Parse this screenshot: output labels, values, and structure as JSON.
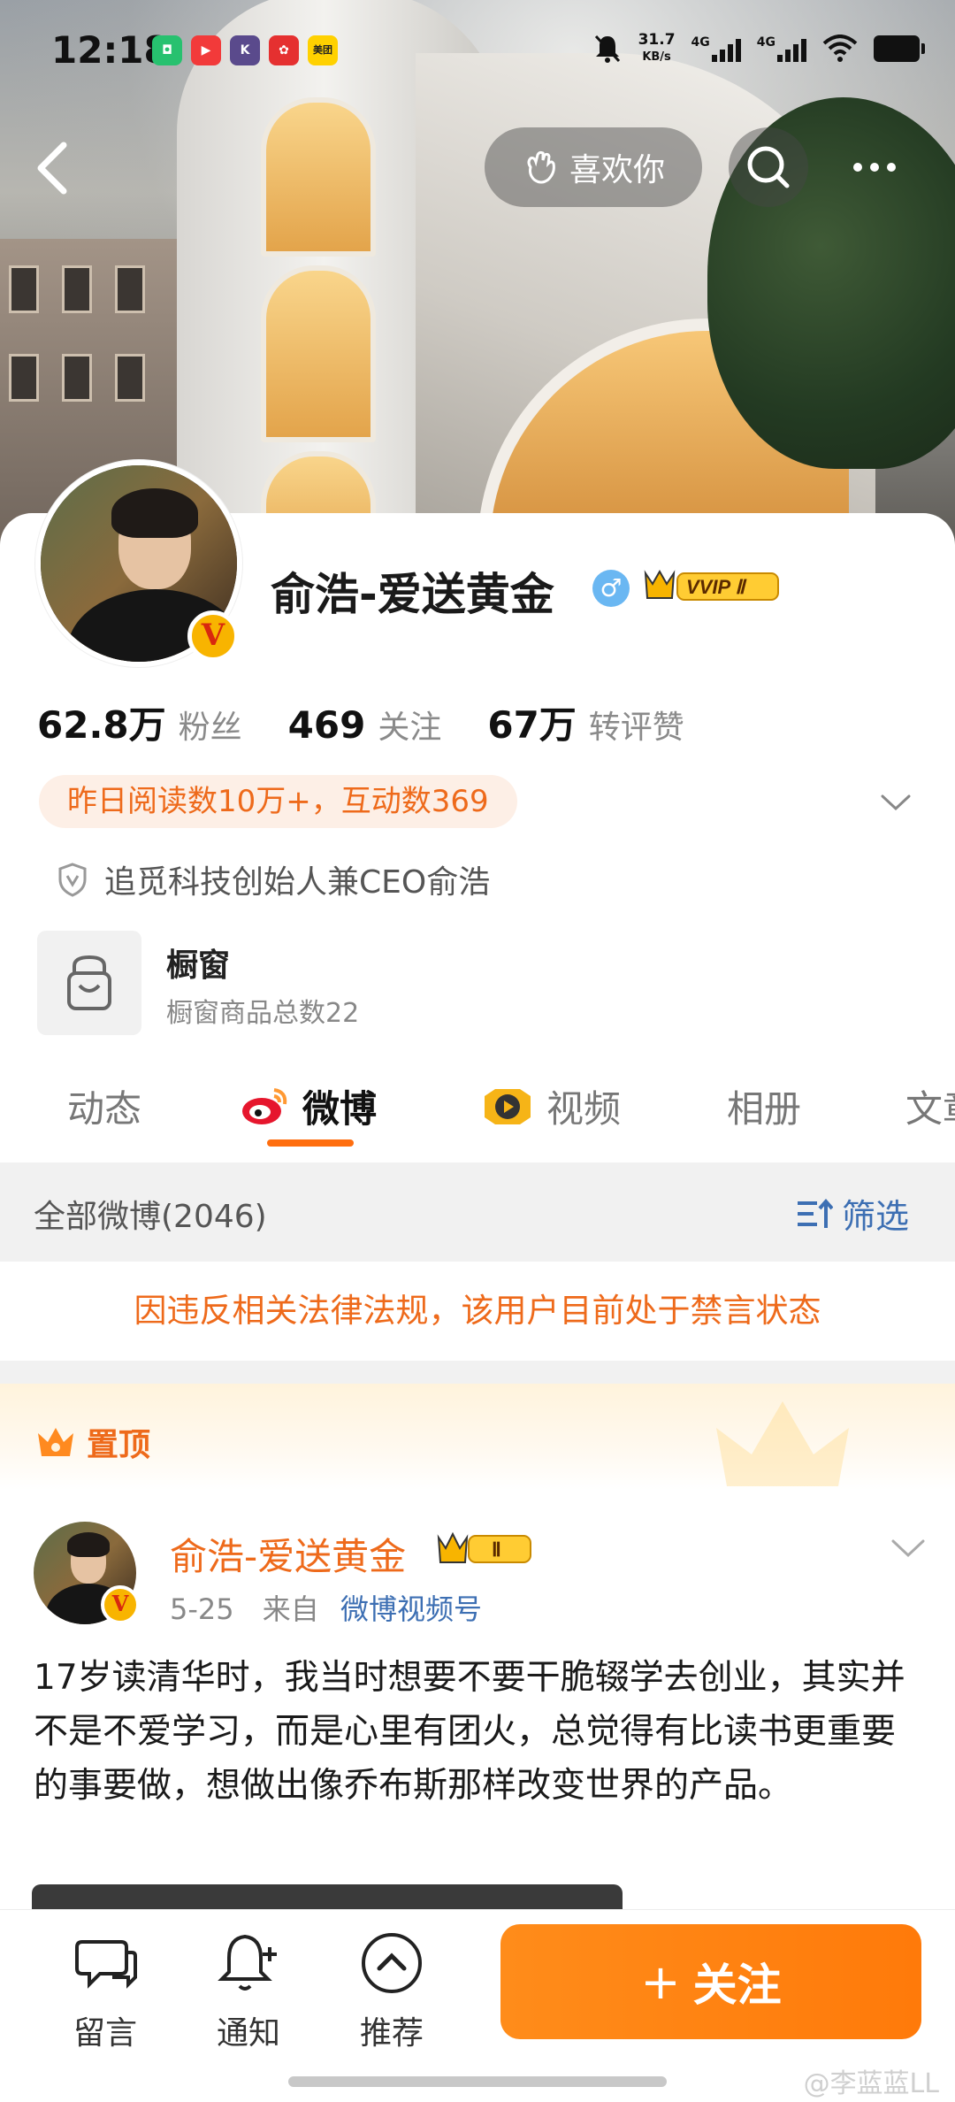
{
  "status_bar": {
    "time": "12:18",
    "network_speed_value": "31.7",
    "network_speed_unit": "KB/s",
    "sig1": "4G",
    "sig2": "4G",
    "app_icons": [
      "xiaomi-app",
      "video-app",
      "k-app",
      "red-app",
      "美团"
    ]
  },
  "nav": {
    "like_label": "喜欢你"
  },
  "profile": {
    "name": "俞浩-爱送黄金",
    "vip_badge": "VVIP Ⅱ",
    "stats": [
      {
        "value": "62.8万",
        "label": "粉丝"
      },
      {
        "value": "469",
        "label": "关注"
      },
      {
        "value": "67万",
        "label": "转评赞"
      }
    ],
    "highlight": "昨日阅读数10万+，互动数369",
    "certification": "追觅科技创始人兼CEO俞浩",
    "shop": {
      "title": "橱窗",
      "subtitle": "橱窗商品总数22"
    }
  },
  "tabs": [
    {
      "label": "动态",
      "active": false
    },
    {
      "label": "微博",
      "active": true
    },
    {
      "label": "视频",
      "active": false
    },
    {
      "label": "相册",
      "active": false
    },
    {
      "label": "文章",
      "active": false
    }
  ],
  "filter": {
    "all_label": "全部微博(2046)",
    "filter_label": "筛选"
  },
  "notice": "因违反相关法律法规，该用户目前处于禁言状态",
  "pinned_label": "置顶",
  "post": {
    "author": "俞浩-爱送黄金",
    "crown_badge": "Ⅱ",
    "date": "5-25",
    "from_prefix": "来自",
    "source": "微博视频号",
    "text": "17岁读清华时，我当时想要不要干脆辍学去创业，其实并不是不爱学习，而是心里有团火，总觉得有比读书更重要的事要做，想做出像乔布斯那样改变世界的产品。"
  },
  "bottom_bar": {
    "items": [
      "留言",
      "通知",
      "推荐"
    ],
    "follow_label": "关注"
  },
  "watermark": "@李蓝蓝LL",
  "colors": {
    "accent": "#ff7a0a",
    "link": "#3d6fb3",
    "badge_gold": "#f8b400"
  }
}
